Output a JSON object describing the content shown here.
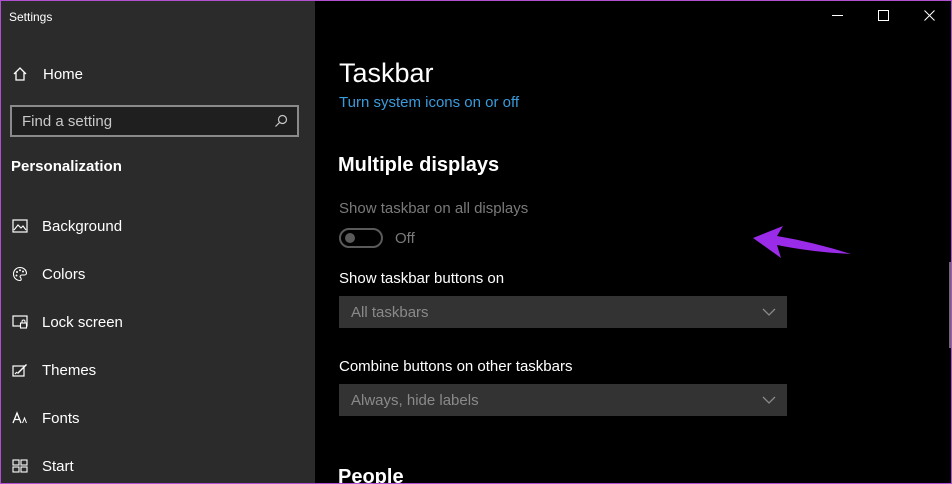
{
  "app_title": "Settings",
  "sidebar": {
    "home_label": "Home",
    "search": {
      "placeholder": "Find a setting"
    },
    "section_header": "Personalization",
    "items": [
      {
        "label": "Background",
        "icon": "picture-icon"
      },
      {
        "label": "Colors",
        "icon": "palette-icon"
      },
      {
        "label": "Lock screen",
        "icon": "lock-screen-icon"
      },
      {
        "label": "Themes",
        "icon": "themes-brush-icon"
      },
      {
        "label": "Fonts",
        "icon": "font-icon"
      },
      {
        "label": "Start",
        "icon": "start-grid-icon"
      }
    ]
  },
  "window_controls": [
    "minimize-icon",
    "maximize-icon",
    "close-icon"
  ],
  "main": {
    "title": "Taskbar",
    "link": "Turn system icons on or off",
    "multiple_displays": {
      "heading": "Multiple displays",
      "show_on_all_label": "Show taskbar on all displays",
      "toggle_state": "Off",
      "toggle_on": false,
      "buttons_on_label": "Show taskbar buttons on",
      "buttons_on_value": "All taskbars",
      "combine_label": "Combine buttons on other taskbars",
      "combine_value": "Always, hide labels"
    },
    "people_heading": "People"
  },
  "colors": {
    "sidebar_bg": "#2b2b2b",
    "main_bg": "#000000",
    "accent_link": "#3a9bdc",
    "annotation_arrow": "#9a2be8"
  }
}
